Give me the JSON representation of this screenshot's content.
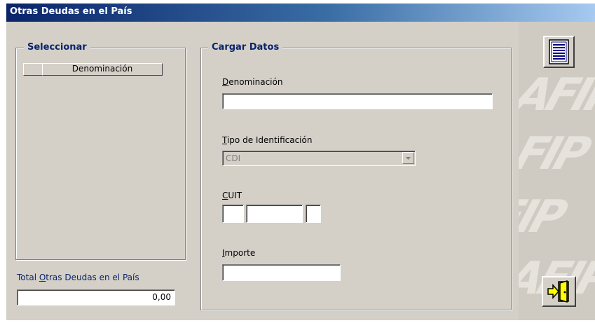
{
  "window": {
    "title": "Otras Deudas en el País"
  },
  "select_group": {
    "title": "Seleccionar",
    "column_header": "Denominación",
    "rows": []
  },
  "total": {
    "label_pre": "Total ",
    "label_u": "O",
    "label_post": "tras Deudas en el País",
    "value": "0,00"
  },
  "form_group": {
    "title": "Cargar Datos",
    "denominacion": {
      "u": "D",
      "rest": "enominación",
      "value": ""
    },
    "tipo_identificacion": {
      "u": "T",
      "rest": "ipo de Identificación",
      "value": "CDI"
    },
    "cuit": {
      "u": "C",
      "rest": "UIT",
      "part1": "",
      "part2": "",
      "part3": ""
    },
    "importe": {
      "u": "I",
      "rest": "mporte",
      "value": ""
    }
  },
  "toolbar": {
    "list_icon": "document-list-icon",
    "exit_icon": "exit-door-icon"
  },
  "watermark": {
    "text": "AFIP"
  },
  "colors": {
    "title_start": "#0a246a",
    "title_end": "#a6caf0",
    "face": "#d4d0c8",
    "group_title": "#0a246a"
  }
}
